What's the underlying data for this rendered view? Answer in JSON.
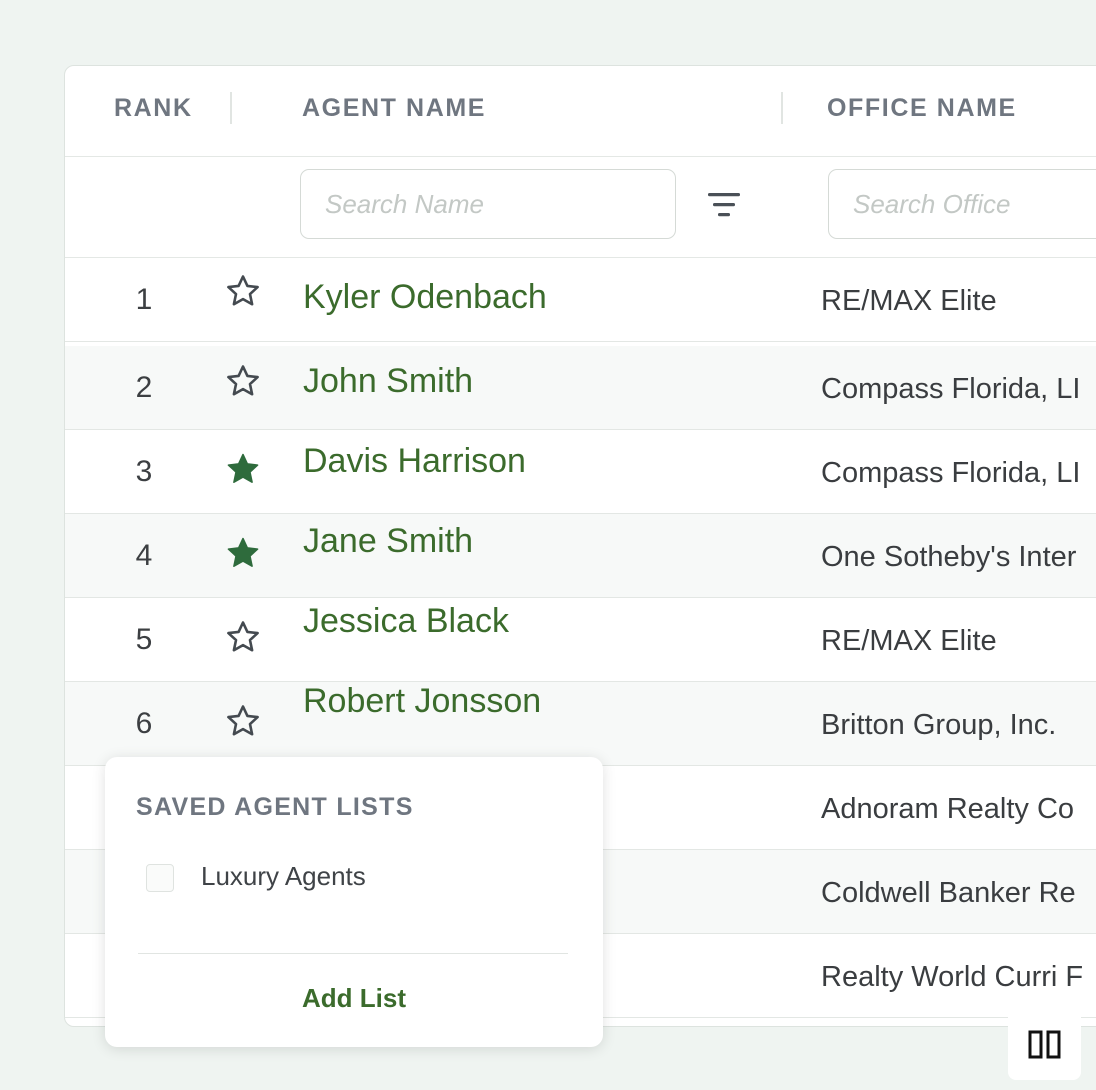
{
  "table": {
    "headers": {
      "rank": "RANK",
      "agent_name": "AGENT NAME",
      "office_name": "OFFICE NAME"
    },
    "filters": {
      "name_placeholder": "Search Name",
      "office_placeholder": "Search Office",
      "filter_icon": "filter-lines-icon"
    },
    "rows": [
      {
        "rank": "1",
        "starred": false,
        "agent": "Kyler Odenbach",
        "office": "RE/MAX Elite"
      },
      {
        "rank": "2",
        "starred": false,
        "agent": "John Smith",
        "office": "Compass Florida, LI"
      },
      {
        "rank": "3",
        "starred": true,
        "agent": "Davis Harrison",
        "office": "Compass Florida, LI"
      },
      {
        "rank": "4",
        "starred": true,
        "agent": "Jane Smith",
        "office": "One Sotheby's Inter"
      },
      {
        "rank": "5",
        "starred": false,
        "agent": "Jessica Black",
        "office": "RE/MAX Elite"
      },
      {
        "rank": "6",
        "starred": false,
        "agent": "Robert Jonsson",
        "office": "Britton Group, Inc."
      },
      {
        "rank": "",
        "starred": false,
        "agent": "",
        "office": "Adnoram Realty Co"
      },
      {
        "rank": "",
        "starred": false,
        "agent": "",
        "office": "Coldwell Banker Re"
      },
      {
        "rank": "",
        "starred": false,
        "agent": "",
        "office": "Realty World Curri F"
      }
    ]
  },
  "popup": {
    "title": "SAVED AGENT LISTS",
    "lists": [
      {
        "label": "Luxury Agents",
        "checked": false
      }
    ],
    "add_label": "Add List"
  },
  "colors": {
    "accent_green": "#3b6b2c",
    "star_filled": "#2e6b3c",
    "background": "#eff4f1"
  },
  "controls": {
    "pause_icon": "pause-icon"
  }
}
